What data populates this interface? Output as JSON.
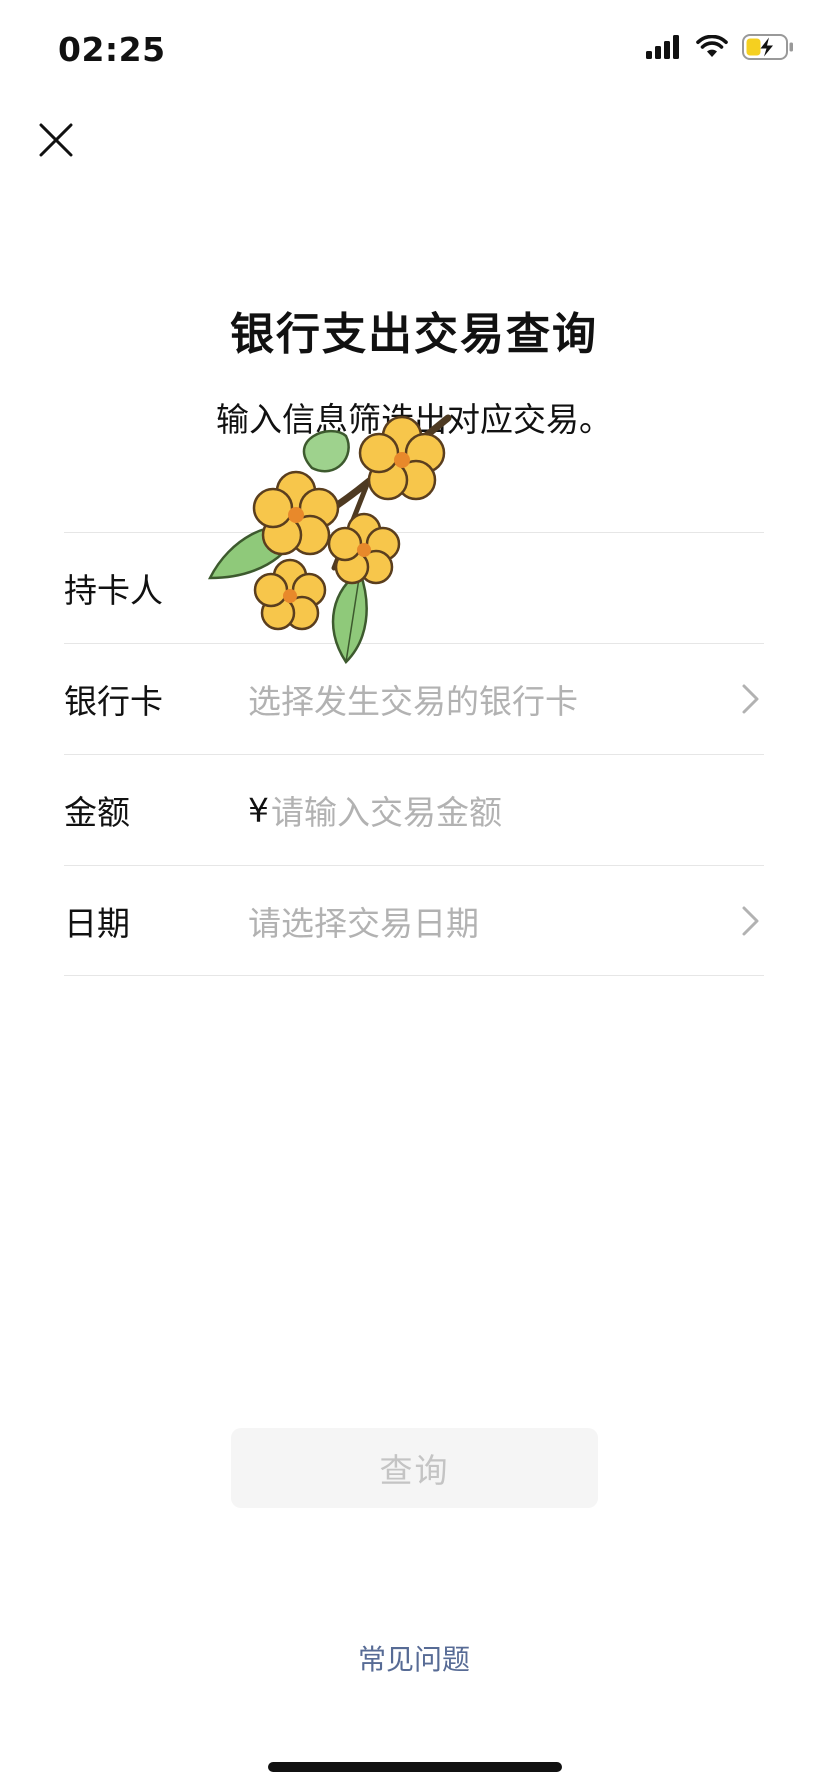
{
  "status_bar": {
    "time": "02:25",
    "icons": [
      "signal-icon",
      "wifi-icon",
      "battery-charging-icon"
    ]
  },
  "header": {
    "close_icon": "close-icon"
  },
  "page": {
    "title": "银行支出交易查询",
    "subtitle": "输入信息筛选出对应交易。"
  },
  "form": {
    "rows": [
      {
        "label": "持卡人",
        "value": "",
        "chevron": false
      },
      {
        "label": "银行卡",
        "placeholder": "选择发生交易的银行卡",
        "chevron": true
      },
      {
        "label": "金额",
        "currency": "¥",
        "placeholder": "请输入交易金额",
        "chevron": false
      },
      {
        "label": "日期",
        "placeholder": "请选择交易日期",
        "chevron": true
      }
    ]
  },
  "actions": {
    "query_label": "查询",
    "faq_label": "常见问题"
  },
  "colors": {
    "link": "#576b95",
    "placeholder": "#b2b2b2",
    "divider": "#e6e6e6",
    "button_disabled_bg": "#f5f5f5",
    "button_disabled_text": "#c4c4c4",
    "battery_fill": "#f5d020"
  }
}
